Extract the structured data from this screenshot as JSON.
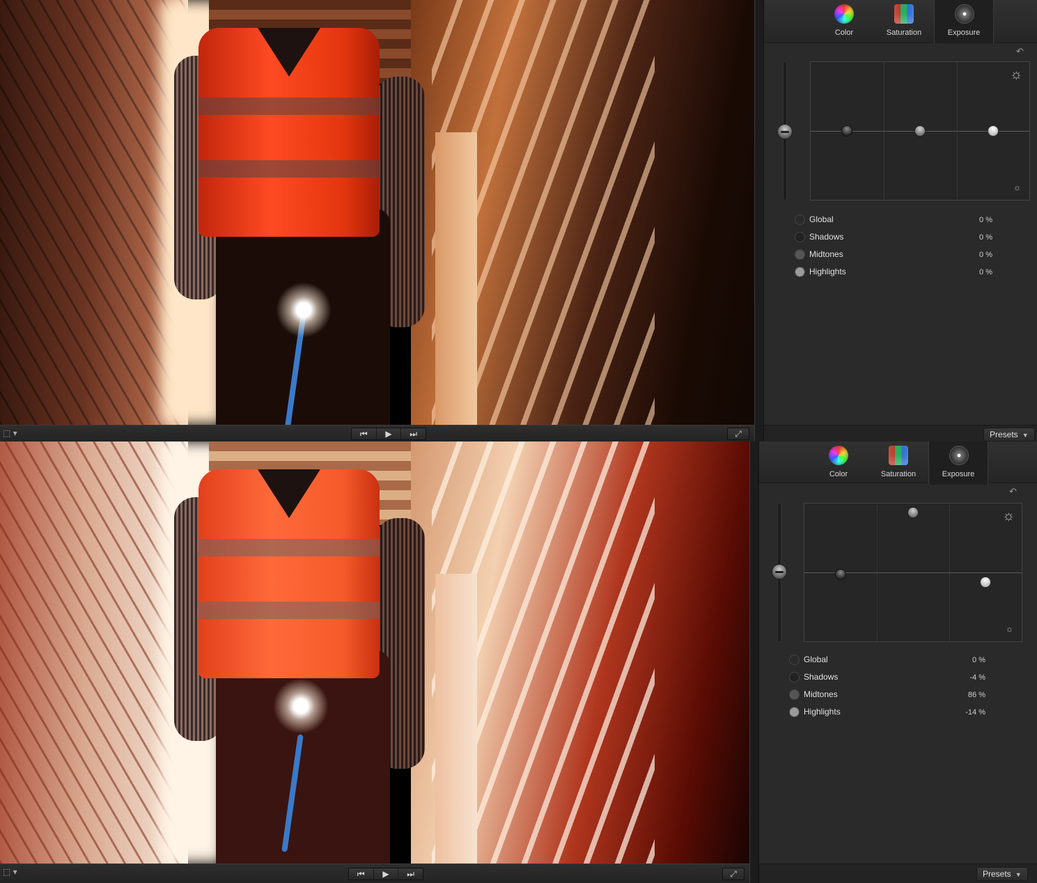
{
  "panels": [
    {
      "tabs": [
        {
          "label": "Color",
          "icon": "color-wheel-icon"
        },
        {
          "label": "Saturation",
          "icon": "saturation-icon"
        },
        {
          "label": "Exposure",
          "icon": "exposure-icon",
          "active": true
        }
      ],
      "rows": [
        {
          "label": "Global",
          "value": "0 %"
        },
        {
          "label": "Shadows",
          "value": "0 %"
        },
        {
          "label": "Midtones",
          "value": "0 %"
        },
        {
          "label": "Highlights",
          "value": "0 %"
        }
      ],
      "presets_label": "Presets"
    },
    {
      "tabs": [
        {
          "label": "Color",
          "icon": "color-wheel-icon"
        },
        {
          "label": "Saturation",
          "icon": "saturation-icon"
        },
        {
          "label": "Exposure",
          "icon": "exposure-icon",
          "active": true
        }
      ],
      "rows": [
        {
          "label": "Global",
          "value": "0 %"
        },
        {
          "label": "Shadows",
          "value": "-4 %"
        },
        {
          "label": "Midtones",
          "value": "86 %"
        },
        {
          "label": "Highlights",
          "value": "-14 %"
        }
      ],
      "presets_label": "Presets"
    }
  ],
  "icons": {
    "reset": "↶",
    "sun_large": "☼",
    "sun_small": "☼",
    "layout_menu": "⬚ ▾",
    "prev": "⏮",
    "play": "▶",
    "next": "⏭",
    "fullscreen": "⤢",
    "caret": "▼"
  },
  "colors": {
    "panel_bg": "#2a2a2a",
    "vest_orange": "#ff4a22",
    "handrail_blue": "#3a7ac8"
  }
}
